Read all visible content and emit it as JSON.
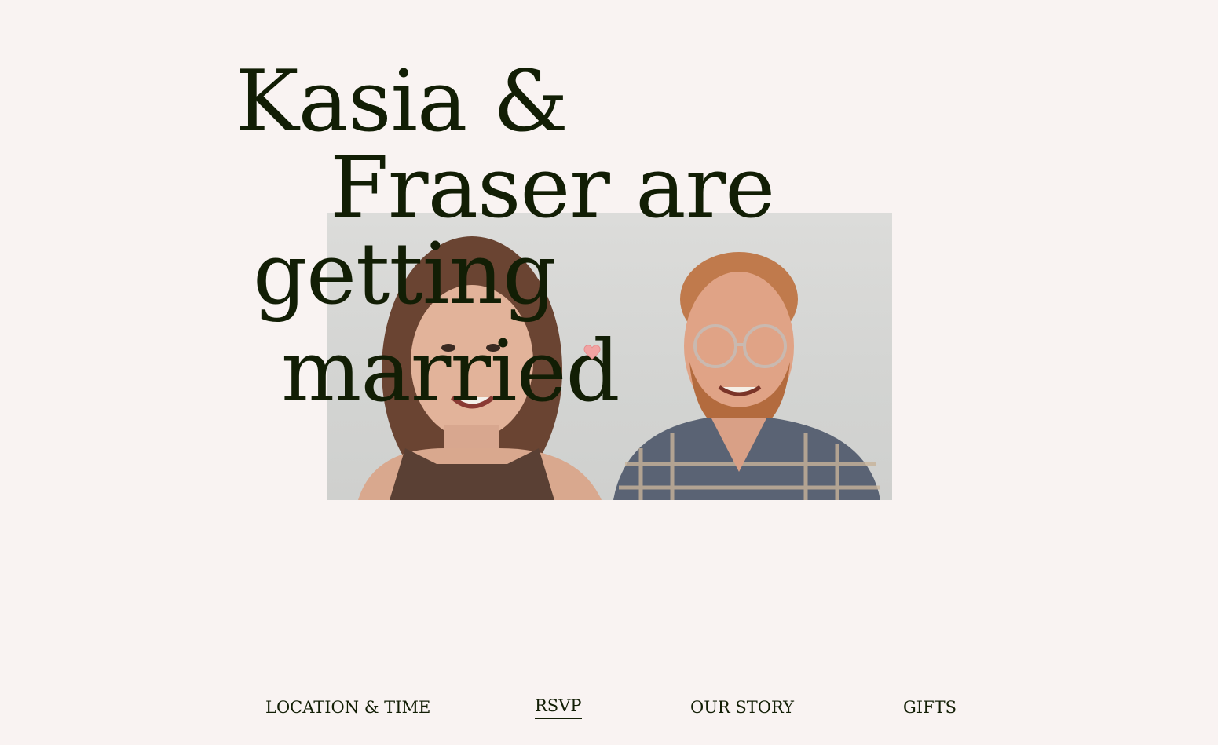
{
  "hero": {
    "title_lines": [
      "Kasia &",
      "Fraser are",
      "getting",
      "married"
    ],
    "heart_icon": "heart-icon",
    "photo_alt": "Kasia and Fraser"
  },
  "nav": {
    "items": [
      {
        "label": "LOCATION & TIME",
        "active": false
      },
      {
        "label": "RSVP",
        "active": true
      },
      {
        "label": "OUR STORY",
        "active": false
      },
      {
        "label": "GIFTS",
        "active": false
      }
    ]
  },
  "colors": {
    "background": "#f9f3f2",
    "text": "#121e05",
    "heart": "#f1a3a3"
  }
}
